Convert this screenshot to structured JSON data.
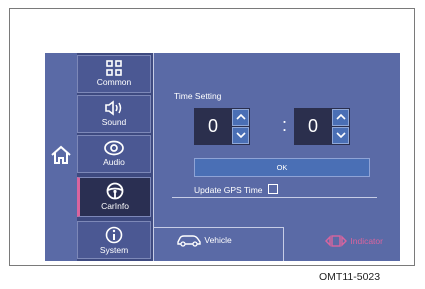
{
  "sidebar": {
    "tabs": [
      {
        "label": "Common",
        "icon": "grid-icon"
      },
      {
        "label": "Sound",
        "icon": "speaker-icon"
      },
      {
        "label": "Audio",
        "icon": "disc-icon"
      },
      {
        "label": "CarInfo",
        "icon": "steering-wheel-icon"
      },
      {
        "label": "System",
        "icon": "info-icon"
      }
    ],
    "active": "CarInfo"
  },
  "time_setting": {
    "label": "Time Setting",
    "hours": "0",
    "minutes": "0",
    "separator": ":"
  },
  "ok_label": "OK",
  "gps": {
    "label": "Update GPS Time",
    "checked": false
  },
  "bottom_tabs": {
    "vehicle": "Vehicle",
    "indicator": "Indicator"
  },
  "caption": "OMT11-5023",
  "colors": {
    "background": "#5a6aa6",
    "sidebar": "#4b5893",
    "active_tab": "#2a2f52",
    "accent_pink": "#d9649e",
    "button_blue": "#4a6fb5"
  }
}
